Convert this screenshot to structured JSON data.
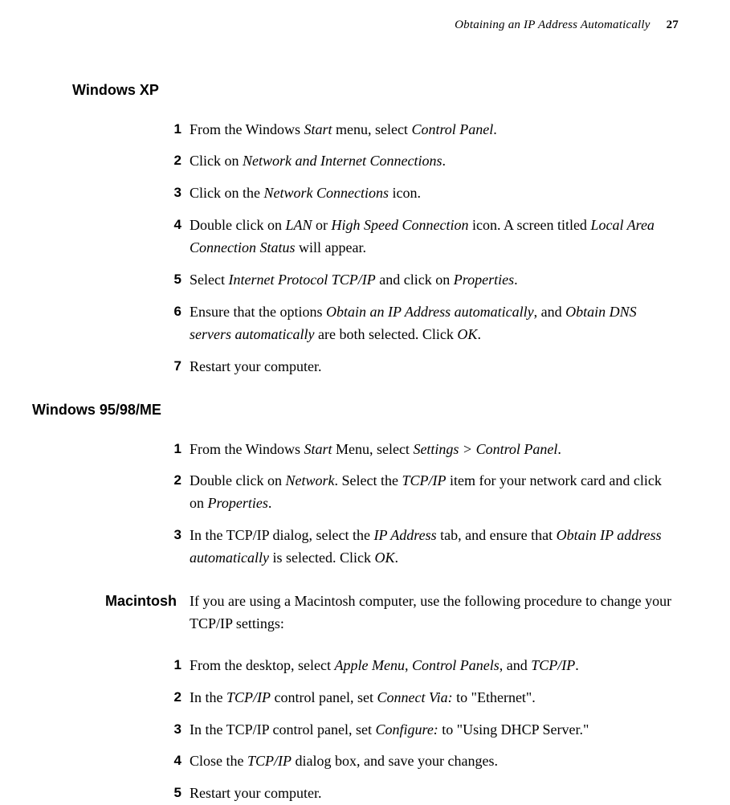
{
  "header": {
    "title": "Obtaining an IP Address Automatically",
    "page": "27"
  },
  "sections": [
    {
      "heading": "Windows XP",
      "heading_class": "",
      "items": [
        {
          "n": "1",
          "html": "From the Windows <em>Start</em> menu, select <em>Control Panel</em>."
        },
        {
          "n": "2",
          "html": "Click on <em>Network and Internet Connections</em>."
        },
        {
          "n": "3",
          "html": "Click on the <em>Network Connections</em> icon."
        },
        {
          "n": "4",
          "html": "Double click on <em>LAN</em> or <em>High Speed Connection</em> icon. A screen titled <em>Local Area Connection Status</em> will appear."
        },
        {
          "n": "5",
          "html": "Select <em>Internet Protocol TCP/IP</em> and click on <em>Properties</em>."
        },
        {
          "n": "6",
          "html": "Ensure that the options <em>Obtain an IP Address automatically</em>, and <em>Obtain DNS servers automatically</em> are both selected. Click <em>OK</em>."
        },
        {
          "n": "7",
          "html": "Restart your computer."
        }
      ]
    },
    {
      "heading": "Windows 95/98/ME",
      "heading_class": "flush",
      "items": [
        {
          "n": "1",
          "html": "From the Windows <em>Start</em> Menu, select <em>Settings > Control Panel</em>."
        },
        {
          "n": "2",
          "html": "Double click on <em>Network</em>. Select the <em>TCP/IP</em> item for your network card and click on <em>Properties</em>."
        },
        {
          "n": "3",
          "html": "In the TCP/IP dialog, select the <em>IP Address</em> tab, and ensure that <em>Obtain IP address automatically</em> is selected. Click <em>OK</em>."
        }
      ]
    },
    {
      "side_label": "Macintosh",
      "intro_html": "If you are using a Macintosh computer, use the following procedure to change your TCP/IP settings:",
      "items": [
        {
          "n": "1",
          "html": "From the desktop, select <em>Apple Menu</em>, <em>Control Panels</em>, and <em>TCP/IP</em>."
        },
        {
          "n": "2",
          "html": "In the <em>TCP/IP</em> control panel, set <em>Connect Via:</em> to \"Ethernet\"."
        },
        {
          "n": "3",
          "html": "In the TCP/IP control panel, set <em>Configure:</em> to \"Using DHCP Server.\""
        },
        {
          "n": "4",
          "html": "Close the <em>TCP/IP</em> dialog box, and save your changes."
        },
        {
          "n": "5",
          "html": "Restart your computer."
        }
      ]
    }
  ]
}
